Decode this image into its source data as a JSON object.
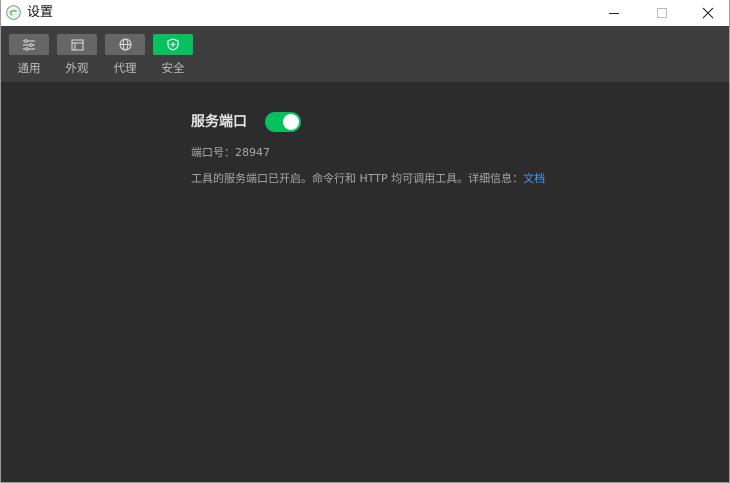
{
  "window": {
    "title": "设置",
    "icon": "wechat-devtools-icon",
    "controls": [
      "minimize-icon",
      "maximize-icon",
      "close-icon"
    ]
  },
  "toolbar": {
    "tabs": [
      {
        "label": "通用",
        "icon": "sliders-icon",
        "active": false
      },
      {
        "label": "外观",
        "icon": "window-layout-icon",
        "active": false
      },
      {
        "label": "代理",
        "icon": "globe-icon",
        "active": false
      },
      {
        "label": "安全",
        "icon": "shield-icon",
        "active": true
      }
    ],
    "accent": "#07c160"
  },
  "security": {
    "service_port_label": "服务端口",
    "service_port_enabled": true,
    "port_line": "端口号：28947",
    "description": "工具的服务端口已开启。命令行和 HTTP 均可调用工具。详细信息：",
    "doc_link": "文档",
    "link_color": "#3e9ff5"
  }
}
